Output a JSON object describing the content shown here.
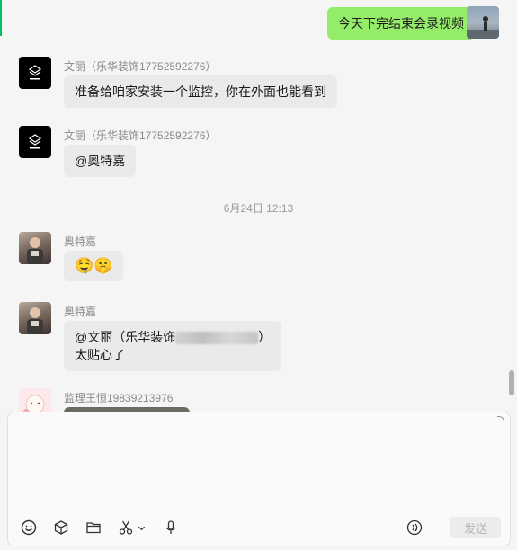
{
  "messages": [
    {
      "sender": "",
      "text": "今天下完结束会录视频",
      "me": true
    },
    {
      "sender": "文丽（乐华装饰17752592276）",
      "text": "准备给咱家安装一个监控，你在外面也能看到"
    },
    {
      "sender": "文丽（乐华装饰17752592276）",
      "text": "@奥特嘉"
    },
    {
      "sender": "奥特嘉",
      "text": "🤤🤫"
    },
    {
      "sender": "奥特嘉",
      "text_line1_pre": "@文丽（乐华装饰",
      "text_line1_post": "）",
      "text_line2": "太贴心了"
    },
    {
      "sender": "监理王恒19839213976"
    }
  ],
  "timestamp": "6月24日 12:13",
  "composer": {
    "placeholder": "",
    "send_label": "发送"
  },
  "toolbar": [
    "emoji-icon",
    "cube-icon",
    "folder-icon",
    "scissors-icon",
    "microphone-icon",
    "voice-call-icon"
  ],
  "colors": {
    "my_bubble": "#95ec69",
    "their_bubble": "#eaeaea",
    "accent": "#07c160"
  }
}
